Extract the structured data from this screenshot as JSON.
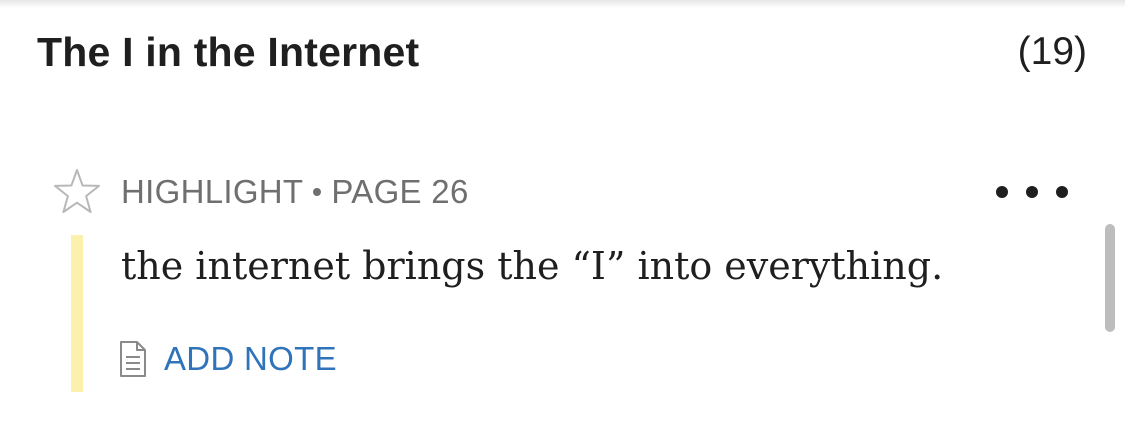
{
  "section": {
    "title": "The I in the Internet",
    "count": "(19)"
  },
  "highlight": {
    "type_label": "HIGHLIGHT",
    "page_label": "PAGE 26",
    "text": "the internet brings the “I” into everything.",
    "highlight_color": "#fbf1ad",
    "favorite_icon": "star-outline-icon",
    "menu_icon": "more-horizontal-icon"
  },
  "note": {
    "add_label": "ADD NOTE",
    "icon": "note-document-icon",
    "accent_color": "#2f73ba"
  }
}
